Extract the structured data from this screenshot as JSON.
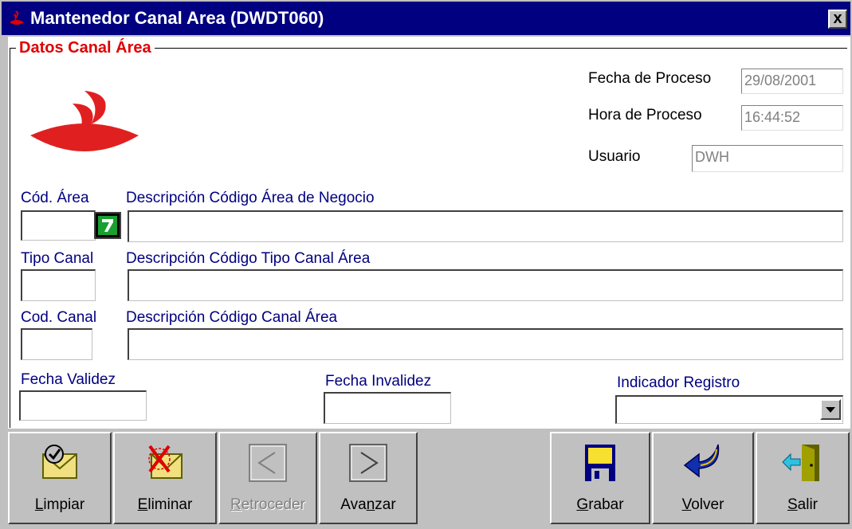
{
  "window": {
    "title": "Mantenedor Canal Area (DWDT060)",
    "close_symbol": "x"
  },
  "group": {
    "title": "Datos Canal Área"
  },
  "header_fields": {
    "fecha_proceso": {
      "label": "Fecha de Proceso",
      "value": "29/08/2001"
    },
    "hora_proceso": {
      "label": "Hora de Proceso",
      "value": "16:44:52"
    },
    "usuario": {
      "label": "Usuario",
      "value": "DWH"
    }
  },
  "fields": {
    "cod_area": {
      "label": "Cód. Área",
      "value": ""
    },
    "desc_area": {
      "label": "Descripción Código Área de Negocio",
      "value": ""
    },
    "tipo_canal": {
      "label": "Tipo Canal",
      "value": ""
    },
    "desc_tipo_canal": {
      "label": "Descripción Código Tipo Canal Área",
      "value": ""
    },
    "cod_canal": {
      "label": "Cod. Canal",
      "value": ""
    },
    "desc_canal": {
      "label": "Descripción Código Canal Área",
      "value": ""
    },
    "fecha_validez": {
      "label": "Fecha Validez",
      "value": ""
    },
    "fecha_invalidez": {
      "label": "Fecha Invalidez",
      "value": ""
    },
    "indicador_registro": {
      "label": "Indicador Registro",
      "selected": ""
    }
  },
  "toolbar": {
    "limpiar": {
      "accel": "L",
      "rest": "impiar",
      "icon": "envelope-check-icon"
    },
    "eliminar": {
      "accel": "E",
      "rest": "liminar",
      "icon": "envelope-delete-icon"
    },
    "retroceder": {
      "accel": "R",
      "rest": "etroceder",
      "icon": "arrow-left-icon",
      "disabled": true
    },
    "avanzar": {
      "pre": "Ava",
      "accel": "n",
      "rest": "zar",
      "icon": "arrow-right-icon"
    },
    "grabar": {
      "accel": "G",
      "rest": "rabar",
      "icon": "floppy-disk-icon"
    },
    "volver": {
      "accel": "V",
      "rest": "olver",
      "icon": "return-arrow-icon"
    },
    "salir": {
      "accel": "S",
      "rest": "alir",
      "icon": "exit-door-icon"
    }
  },
  "colors": {
    "titlebar": "#000080",
    "group_title": "#e00000",
    "logo": "#e02020"
  }
}
